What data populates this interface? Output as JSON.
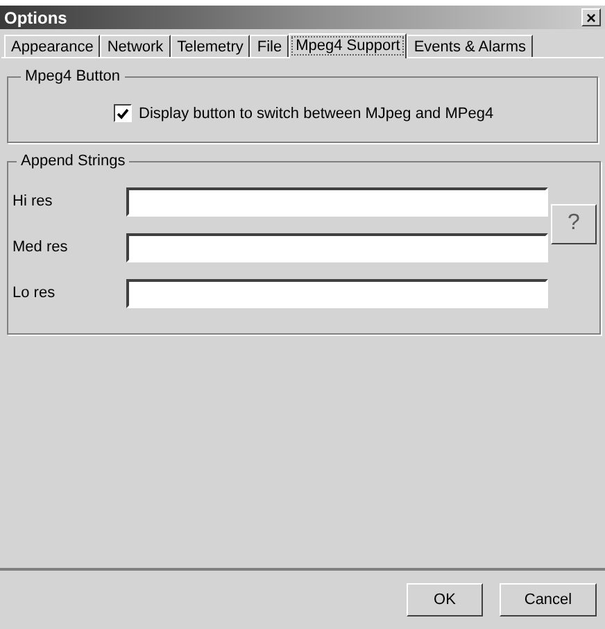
{
  "window": {
    "title": "Options",
    "close": "×"
  },
  "tabs": [
    {
      "label": "Appearance",
      "selected": false
    },
    {
      "label": "Network",
      "selected": false
    },
    {
      "label": "Telemetry",
      "selected": false
    },
    {
      "label": "File",
      "selected": false
    },
    {
      "label": "Mpeg4 Support",
      "selected": true
    },
    {
      "label": "Events & Alarms",
      "selected": false
    }
  ],
  "mpeg4_group": {
    "title": "Mpeg4 Button",
    "checkbox": {
      "label": "Display button to switch between MJpeg and MPeg4",
      "checked": true
    }
  },
  "append_group": {
    "title": "Append Strings",
    "fields": [
      {
        "label": "Hi res"
      },
      {
        "label": "Med res"
      },
      {
        "label": "Lo res"
      }
    ],
    "help_button": "?"
  },
  "buttons": [
    "OK",
    "Cancel"
  ]
}
